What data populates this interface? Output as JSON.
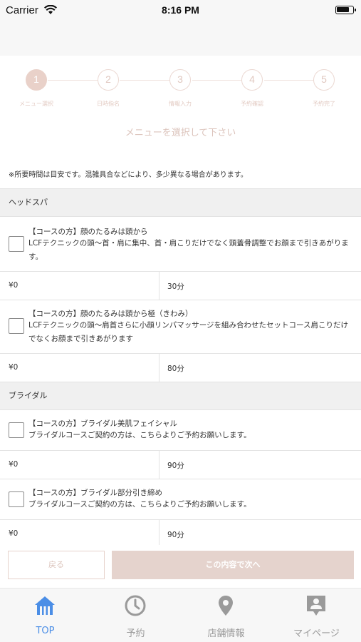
{
  "status_bar": {
    "carrier": "Carrier",
    "time": "8:16 PM"
  },
  "steps": [
    {
      "number": "1",
      "label": "メニュー選択",
      "active": true
    },
    {
      "number": "2",
      "label": "日時指名",
      "active": false
    },
    {
      "number": "3",
      "label": "情報入力",
      "active": false
    },
    {
      "number": "4",
      "label": "予約確認",
      "active": false
    },
    {
      "number": "5",
      "label": "予約完了",
      "active": false
    }
  ],
  "instruction": "メニューを選択して下さい",
  "note": "※所要時間は目安です。混雑具合などにより、多少異なる場合があります。",
  "sections": [
    {
      "name": "ヘッドスパ",
      "items": [
        {
          "title": "【コースの方】顔のたるみは頭から",
          "description": "LCFテクニックの頭〜首・肩に集中、首・肩こりだけでなく頭蓋骨調整でお顔まで引きあがります。",
          "price": "¥0",
          "duration": "30分"
        },
        {
          "title": "【コースの方】顔のたるみは頭から極（きわみ）",
          "description": "LCFテクニックの頭〜肩首さらに小顔リンパマッサージを組み合わせたセットコース肩こりだけでなくお顔まで引きあがります",
          "price": "¥0",
          "duration": "80分"
        }
      ]
    },
    {
      "name": "ブライダル",
      "items": [
        {
          "title": "【コースの方】ブライダル美肌フェイシャル",
          "description": "ブライダルコースご契約の方は、こちらよりご予約お願いします。",
          "price": "¥0",
          "duration": "90分"
        },
        {
          "title": "【コースの方】ブライダル部分引き締め",
          "description": "ブライダルコースご契約の方は、こちらよりご予約お願いします。",
          "price": "¥0",
          "duration": "90分"
        }
      ]
    }
  ],
  "buttons": {
    "back": "戻る",
    "next": "この内容で次へ"
  },
  "tabs": [
    {
      "label": "TOP",
      "icon": "home-icon",
      "active": true
    },
    {
      "label": "予約",
      "icon": "clock-icon",
      "active": false
    },
    {
      "label": "店舗情報",
      "icon": "map-pin-icon",
      "active": false
    },
    {
      "label": "マイページ",
      "icon": "account-icon",
      "active": false
    }
  ],
  "colors": {
    "accent": "#4b8ee6",
    "step_active": "#e9d1c9",
    "next_button": "#e5d3cd"
  }
}
